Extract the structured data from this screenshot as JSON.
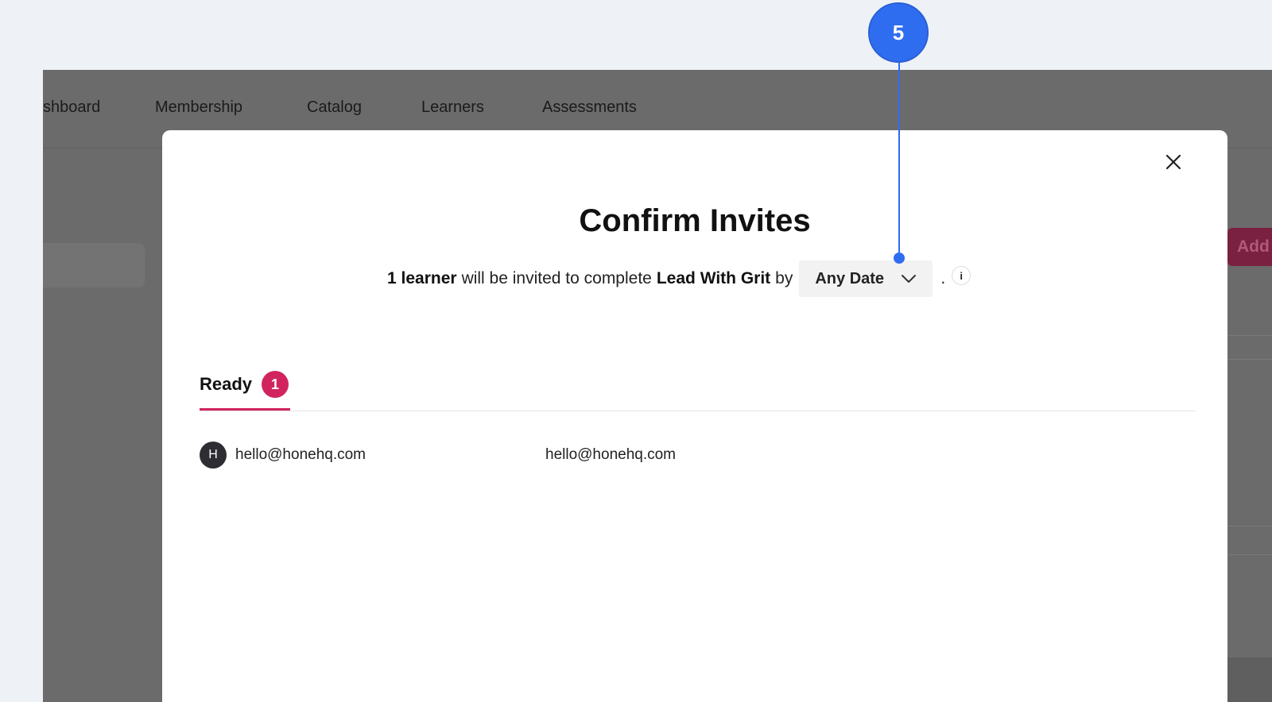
{
  "nav": {
    "items": [
      "shboard",
      "Membership",
      "Catalog",
      "Learners",
      "Assessments"
    ]
  },
  "background": {
    "add_button_label": "Add l"
  },
  "modal": {
    "title": "Confirm Invites",
    "subtitle": {
      "count_bold": "1 learner",
      "middle_text": "will be invited to complete",
      "course_bold": "Lead With Grit",
      "by_text": "by",
      "period": "."
    },
    "date_select": {
      "selected": "Any Date",
      "icon": "chevron-down-icon"
    },
    "info_icon_glyph": "i",
    "close_icon": "close-icon",
    "tabs": [
      {
        "label": "Ready",
        "count": "1"
      }
    ],
    "rows": [
      {
        "avatar_initial": "H",
        "name": "hello@honehq.com",
        "email": "hello@honehq.com"
      }
    ]
  },
  "annotation": {
    "step_number": "5"
  },
  "colors": {
    "accent_pink": "#d1245f",
    "annotation_blue": "#2f6df0",
    "overlay_gray": "#6b6b6b",
    "page_bg": "#eef2f7"
  }
}
